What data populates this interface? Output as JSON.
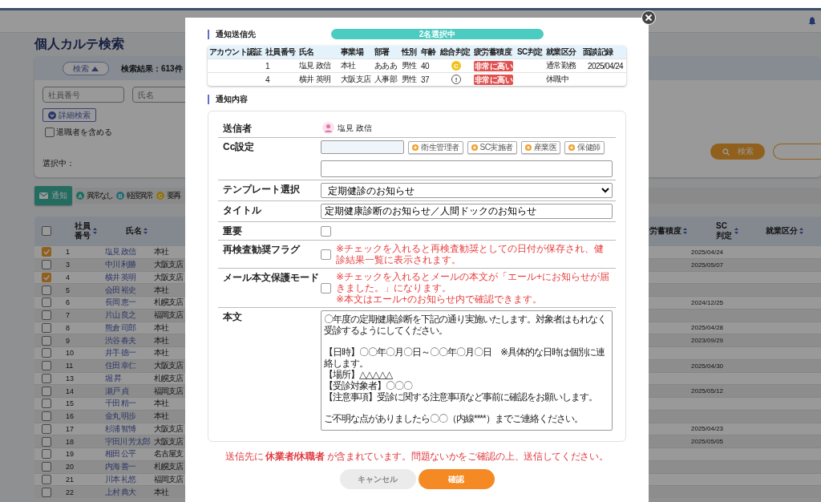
{
  "page": {
    "title": "個人カルテ検索"
  },
  "search_panel": {
    "toggle_button": "検索",
    "result_count": "検索結果：613件",
    "fields": [
      {
        "placeholder": "社員番号"
      },
      {
        "placeholder": "氏名"
      }
    ],
    "advanced_button": "詳細検索",
    "include_retired": {
      "label": "退職者を含める",
      "checked": false
    },
    "selection_label": "選択中：",
    "search_button": "検索"
  },
  "notify_button": "通知",
  "legend": [
    {
      "letter": "A",
      "label": "異常なし",
      "color": "#1c6d60"
    },
    {
      "letter": "B",
      "label": "軽度異常",
      "color": "#256b77"
    },
    {
      "letter": "C",
      "label": "要再",
      "color": "#917410"
    }
  ],
  "table": {
    "select_all_checked": false,
    "columns": [
      "社員番号",
      "氏名",
      "労蓄積度",
      "SC判定",
      "就業区分"
    ],
    "rows": [
      {
        "checked": true,
        "no": "1",
        "name": "塩見 政信",
        "office": "本社",
        "date": "2025/04/24"
      },
      {
        "checked": false,
        "no": "3",
        "name": "中川 利勝",
        "office": "大阪支店",
        "date": "2025/05/07"
      },
      {
        "checked": true,
        "no": "4",
        "name": "横井 英明",
        "office": "大阪支店"
      },
      {
        "checked": false,
        "no": "5",
        "name": "会田 裕史",
        "office": "本社"
      },
      {
        "checked": false,
        "no": "6",
        "name": "長岡 恵一",
        "office": "札幌支店",
        "date": "2024/12/25"
      },
      {
        "checked": false,
        "no": "7",
        "name": "片山 良之",
        "office": "福岡支店"
      },
      {
        "checked": false,
        "no": "8",
        "name": "熊倉 司郎",
        "office": "本社",
        "date": "2025/04/28"
      },
      {
        "checked": false,
        "no": "9",
        "name": "渋谷 春夫",
        "office": "本社",
        "date": "2023/09/29"
      },
      {
        "checked": false,
        "no": "10",
        "name": "井手 徳一",
        "office": "本社"
      },
      {
        "checked": false,
        "no": "11",
        "name": "住田 幸仁",
        "office": "大阪支店",
        "date": "2025/04/30"
      },
      {
        "checked": false,
        "no": "13",
        "name": "堀 昇",
        "office": "札幌支店"
      },
      {
        "checked": false,
        "no": "14",
        "name": "瀬戸 貞",
        "office": "福岡支店",
        "date": "2025/05/12"
      },
      {
        "checked": false,
        "no": "15",
        "name": "千田 精一",
        "office": "本社"
      },
      {
        "checked": false,
        "no": "16",
        "name": "金丸 明歩",
        "office": "本社"
      },
      {
        "checked": false,
        "no": "17",
        "name": "杉浦 智博",
        "office": "大阪支店",
        "date": "2025/04/23"
      },
      {
        "checked": false,
        "no": "18",
        "name": "宇田川 芳太郎",
        "office": "大阪支店",
        "date": "2025/05/05"
      },
      {
        "checked": false,
        "no": "19",
        "name": "相田 公平",
        "office": "名古屋支"
      },
      {
        "checked": false,
        "no": "20",
        "name": "内海 善一",
        "office": "札幌支店"
      },
      {
        "checked": false,
        "no": "21",
        "name": "川本 礼悠",
        "office": "福岡支店"
      },
      {
        "checked": false,
        "no": "22",
        "name": "上村 典大",
        "office": "本社"
      }
    ]
  },
  "modal": {
    "recipients_heading": "通知送信先",
    "selected_count": "2名選択中",
    "recipients_table": {
      "columns": [
        "アカウント認証",
        "社員番号",
        "氏名",
        "事業場",
        "部署",
        "性別",
        "年齢",
        "総合判定",
        "疲労蓄積度",
        "SC判定",
        "就業区分",
        "面談記録"
      ],
      "rows": [
        {
          "employee_no": "1",
          "name": "塩見 政信",
          "office": "本社",
          "department": "あああ",
          "gender": "男性",
          "age": "40",
          "overall": {
            "kind": "grade",
            "label": "C"
          },
          "fatigue": "非常に高い",
          "work_status": "通常勤務",
          "interview": "2025/04/24"
        },
        {
          "employee_no": "4",
          "name": "横井 英明",
          "office": "大阪支店",
          "department": "人事部",
          "gender": "男性",
          "age": "37",
          "overall": {
            "kind": "alert",
            "label": "!"
          },
          "fatigue": "非常に高い",
          "work_status": "休職中"
        }
      ]
    },
    "content_heading": "通知内容",
    "form": {
      "sender_label": "送信者",
      "sender_name": "塩見 政信",
      "cc_label": "Cc設定",
      "cc_buttons": [
        "衛生管理者",
        "SC実施者",
        "産業医",
        "保健師"
      ],
      "template_label": "テンプレート選択",
      "template_value": "定期健診のお知らせ",
      "title_label": "タイトル",
      "title_value": "定期健康診断のお知らせ／人間ドックのお知らせ",
      "flags": [
        {
          "label": "重要",
          "checked": false
        },
        {
          "label": "再検査勧奨フラグ",
          "checked": false,
          "notes": [
            "※チェックを入れると再検査勧奨としての日付が保存され、健診結果一覧に表示されます。"
          ]
        },
        {
          "label": "メール本文保護モード",
          "checked": false,
          "notes": [
            "※チェックを入れるとメールの本文が「エール+にお知らせが届きました。」になります。",
            "※本文はエール+のお知らせ内で確認できます。"
          ]
        }
      ],
      "body_label": "本文",
      "body_paragraphs": [
        [
          "〇年度の定期健康診断を下記の通り実施いたします。対象者はもれなく受診するようにしてください。"
        ],
        [
          "【日時】〇〇年〇月〇日～〇〇年〇月〇日　※具体的な日時は個別に連絡します。",
          "【場所】△△△△△",
          "【受診対象者】〇〇〇",
          "【注意事項】受診に関する注意事項など事前に確認をお願いします。"
        ],
        [
          "ご不明な点がありましたら〇〇（内線****）までご連絡ください。"
        ]
      ]
    },
    "warning": "送信先に **休業者/休職者** が含まれています。問題ないかをご確認の上、送信してください。",
    "buttons": [
      {
        "label": "キャンセル",
        "kind": "secondary"
      },
      {
        "label": "確認",
        "kind": "primary"
      }
    ]
  }
}
